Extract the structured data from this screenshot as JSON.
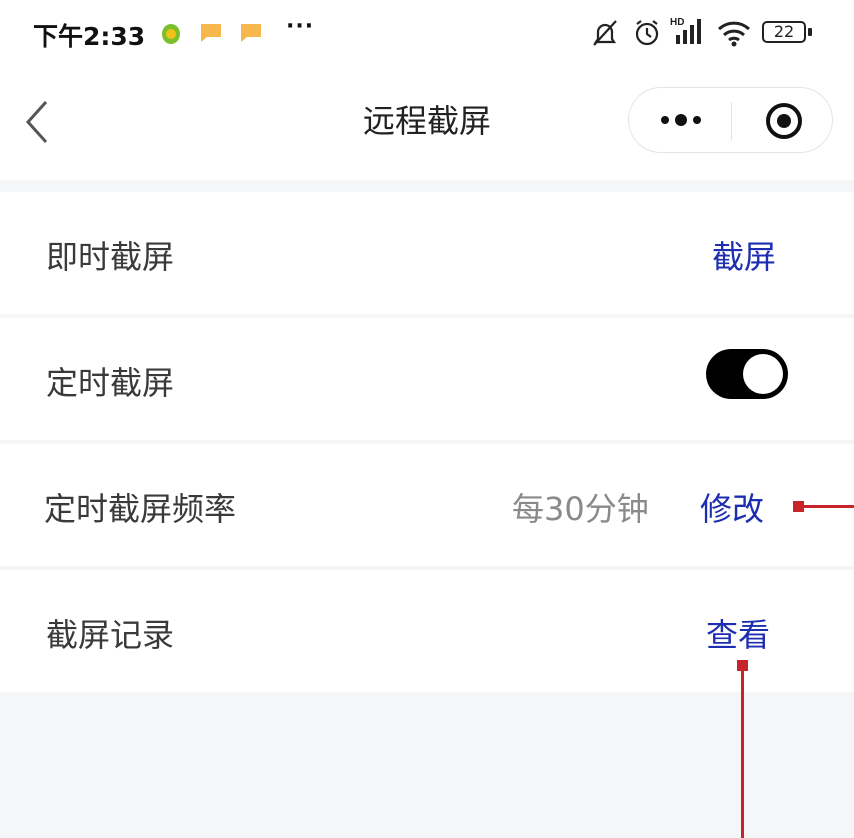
{
  "status_bar": {
    "time": "下午2:33",
    "more": "···",
    "battery": "22",
    "icons": [
      "lotus-app-icon",
      "message-icon",
      "message-icon",
      "mute-bell-icon",
      "alarm-icon",
      "hd-signal-icon",
      "wifi-icon",
      "battery-icon"
    ]
  },
  "nav": {
    "title": "远程截屏",
    "back_icon": "chevron-left-icon",
    "more_icon": "more-dots-icon",
    "close_icon": "target-icon"
  },
  "rows": [
    {
      "label": "即时截屏",
      "action": "截屏"
    },
    {
      "label": "定时截屏",
      "toggle_on": true
    },
    {
      "label": "定时截屏频率",
      "value": "每30分钟",
      "action": "修改"
    },
    {
      "label": "截屏记录",
      "action": "查看"
    }
  ],
  "colors": {
    "accent": "#1d2fb0",
    "annotation": "#c8232b",
    "background": "#f4f6f7"
  }
}
